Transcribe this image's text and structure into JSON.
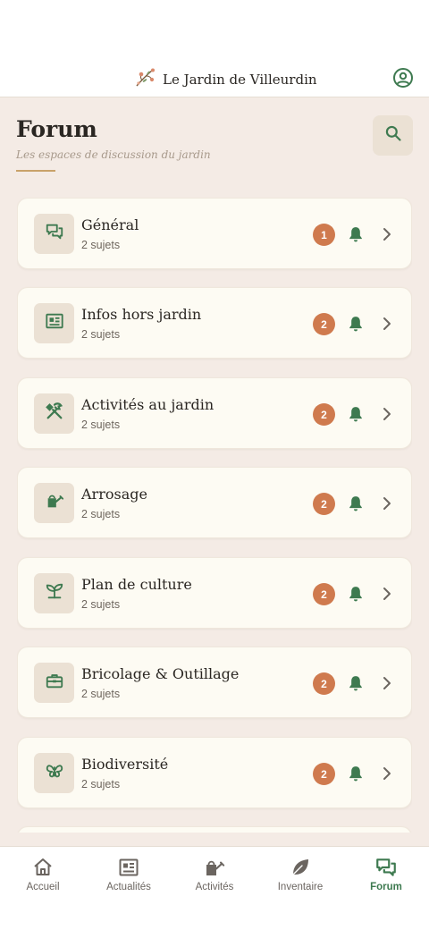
{
  "app": {
    "title": "Le Jardin de Villeurdin"
  },
  "page": {
    "title": "Forum",
    "subtitle": "Les espaces de discussion du jardin"
  },
  "colors": {
    "accent": "#3e7a50",
    "badge": "#cf7a4e",
    "card_bg": "#fdfbf3",
    "page_bg": "#f4ebe5",
    "icon_bg": "#ebe1d4",
    "rule": "#c9a26a"
  },
  "forums": [
    {
      "name": "Général",
      "topics": "2 sujets",
      "count": "1",
      "icon": "chat-icon"
    },
    {
      "name": "Infos hors jardin",
      "topics": "2 sujets",
      "count": "2",
      "icon": "newspaper-icon"
    },
    {
      "name": "Activités au jardin",
      "topics": "2 sujets",
      "count": "2",
      "icon": "tools-icon"
    },
    {
      "name": "Arrosage",
      "topics": "2 sujets",
      "count": "2",
      "icon": "watering-can-icon"
    },
    {
      "name": "Plan de culture",
      "topics": "2 sujets",
      "count": "2",
      "icon": "sprout-icon"
    },
    {
      "name": "Bricolage & Outillage",
      "topics": "2 sujets",
      "count": "2",
      "icon": "toolbox-icon"
    },
    {
      "name": "Biodiversité",
      "topics": "2 sujets",
      "count": "2",
      "icon": "butterfly-icon"
    }
  ],
  "tabs": [
    {
      "label": "Accueil",
      "icon": "home-icon",
      "active": false
    },
    {
      "label": "Actualités",
      "icon": "newspaper-icon",
      "active": false
    },
    {
      "label": "Activités",
      "icon": "watering-can-icon",
      "active": false
    },
    {
      "label": "Inventaire",
      "icon": "leaf-icon",
      "active": false
    },
    {
      "label": "Forum",
      "icon": "forum-icon",
      "active": true
    }
  ]
}
